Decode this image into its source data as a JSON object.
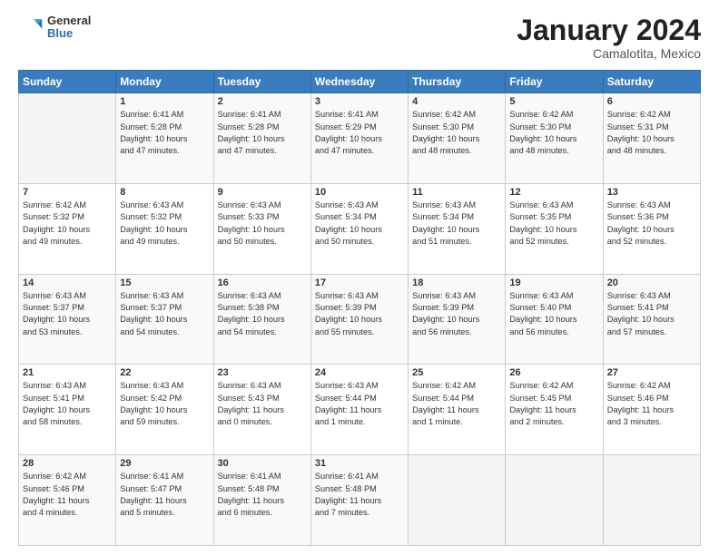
{
  "header": {
    "logo_line1": "General",
    "logo_line2": "Blue",
    "title": "January 2024",
    "subtitle": "Camalotita, Mexico"
  },
  "days_of_week": [
    "Sunday",
    "Monday",
    "Tuesday",
    "Wednesday",
    "Thursday",
    "Friday",
    "Saturday"
  ],
  "weeks": [
    [
      {
        "day": "",
        "info": ""
      },
      {
        "day": "1",
        "info": "Sunrise: 6:41 AM\nSunset: 5:28 PM\nDaylight: 10 hours\nand 47 minutes."
      },
      {
        "day": "2",
        "info": "Sunrise: 6:41 AM\nSunset: 5:28 PM\nDaylight: 10 hours\nand 47 minutes."
      },
      {
        "day": "3",
        "info": "Sunrise: 6:41 AM\nSunset: 5:29 PM\nDaylight: 10 hours\nand 47 minutes."
      },
      {
        "day": "4",
        "info": "Sunrise: 6:42 AM\nSunset: 5:30 PM\nDaylight: 10 hours\nand 48 minutes."
      },
      {
        "day": "5",
        "info": "Sunrise: 6:42 AM\nSunset: 5:30 PM\nDaylight: 10 hours\nand 48 minutes."
      },
      {
        "day": "6",
        "info": "Sunrise: 6:42 AM\nSunset: 5:31 PM\nDaylight: 10 hours\nand 48 minutes."
      }
    ],
    [
      {
        "day": "7",
        "info": "Sunrise: 6:42 AM\nSunset: 5:32 PM\nDaylight: 10 hours\nand 49 minutes."
      },
      {
        "day": "8",
        "info": "Sunrise: 6:43 AM\nSunset: 5:32 PM\nDaylight: 10 hours\nand 49 minutes."
      },
      {
        "day": "9",
        "info": "Sunrise: 6:43 AM\nSunset: 5:33 PM\nDaylight: 10 hours\nand 50 minutes."
      },
      {
        "day": "10",
        "info": "Sunrise: 6:43 AM\nSunset: 5:34 PM\nDaylight: 10 hours\nand 50 minutes."
      },
      {
        "day": "11",
        "info": "Sunrise: 6:43 AM\nSunset: 5:34 PM\nDaylight: 10 hours\nand 51 minutes."
      },
      {
        "day": "12",
        "info": "Sunrise: 6:43 AM\nSunset: 5:35 PM\nDaylight: 10 hours\nand 52 minutes."
      },
      {
        "day": "13",
        "info": "Sunrise: 6:43 AM\nSunset: 5:36 PM\nDaylight: 10 hours\nand 52 minutes."
      }
    ],
    [
      {
        "day": "14",
        "info": "Sunrise: 6:43 AM\nSunset: 5:37 PM\nDaylight: 10 hours\nand 53 minutes."
      },
      {
        "day": "15",
        "info": "Sunrise: 6:43 AM\nSunset: 5:37 PM\nDaylight: 10 hours\nand 54 minutes."
      },
      {
        "day": "16",
        "info": "Sunrise: 6:43 AM\nSunset: 5:38 PM\nDaylight: 10 hours\nand 54 minutes."
      },
      {
        "day": "17",
        "info": "Sunrise: 6:43 AM\nSunset: 5:39 PM\nDaylight: 10 hours\nand 55 minutes."
      },
      {
        "day": "18",
        "info": "Sunrise: 6:43 AM\nSunset: 5:39 PM\nDaylight: 10 hours\nand 56 minutes."
      },
      {
        "day": "19",
        "info": "Sunrise: 6:43 AM\nSunset: 5:40 PM\nDaylight: 10 hours\nand 56 minutes."
      },
      {
        "day": "20",
        "info": "Sunrise: 6:43 AM\nSunset: 5:41 PM\nDaylight: 10 hours\nand 57 minutes."
      }
    ],
    [
      {
        "day": "21",
        "info": "Sunrise: 6:43 AM\nSunset: 5:41 PM\nDaylight: 10 hours\nand 58 minutes."
      },
      {
        "day": "22",
        "info": "Sunrise: 6:43 AM\nSunset: 5:42 PM\nDaylight: 10 hours\nand 59 minutes."
      },
      {
        "day": "23",
        "info": "Sunrise: 6:43 AM\nSunset: 5:43 PM\nDaylight: 11 hours\nand 0 minutes."
      },
      {
        "day": "24",
        "info": "Sunrise: 6:43 AM\nSunset: 5:44 PM\nDaylight: 11 hours\nand 1 minute."
      },
      {
        "day": "25",
        "info": "Sunrise: 6:42 AM\nSunset: 5:44 PM\nDaylight: 11 hours\nand 1 minute."
      },
      {
        "day": "26",
        "info": "Sunrise: 6:42 AM\nSunset: 5:45 PM\nDaylight: 11 hours\nand 2 minutes."
      },
      {
        "day": "27",
        "info": "Sunrise: 6:42 AM\nSunset: 5:46 PM\nDaylight: 11 hours\nand 3 minutes."
      }
    ],
    [
      {
        "day": "28",
        "info": "Sunrise: 6:42 AM\nSunset: 5:46 PM\nDaylight: 11 hours\nand 4 minutes."
      },
      {
        "day": "29",
        "info": "Sunrise: 6:41 AM\nSunset: 5:47 PM\nDaylight: 11 hours\nand 5 minutes."
      },
      {
        "day": "30",
        "info": "Sunrise: 6:41 AM\nSunset: 5:48 PM\nDaylight: 11 hours\nand 6 minutes."
      },
      {
        "day": "31",
        "info": "Sunrise: 6:41 AM\nSunset: 5:48 PM\nDaylight: 11 hours\nand 7 minutes."
      },
      {
        "day": "",
        "info": ""
      },
      {
        "day": "",
        "info": ""
      },
      {
        "day": "",
        "info": ""
      }
    ]
  ]
}
